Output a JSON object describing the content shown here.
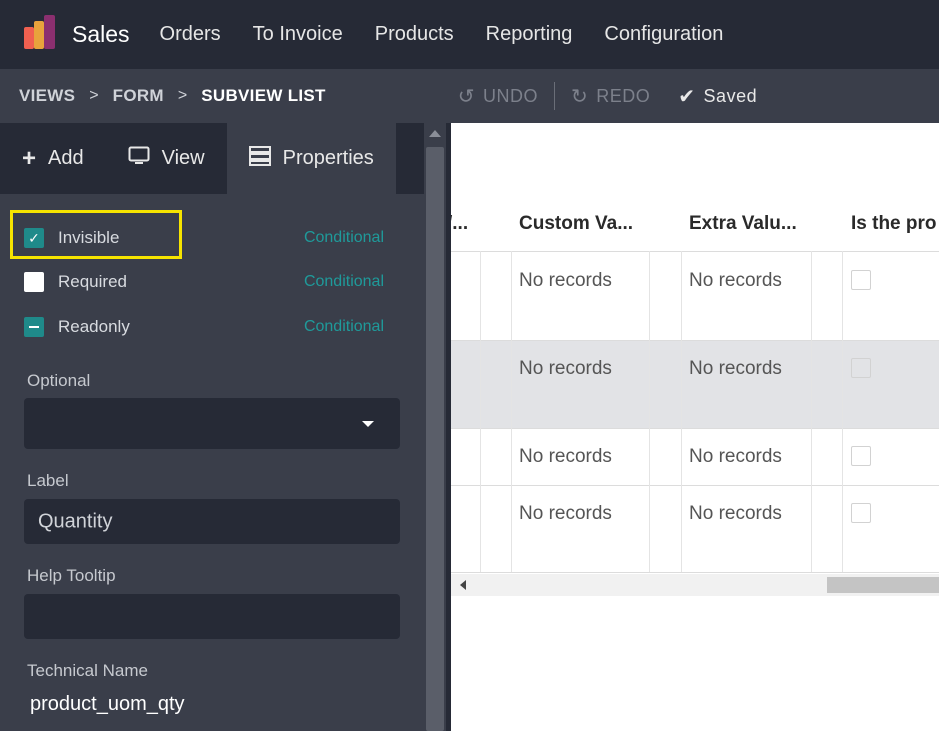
{
  "app": {
    "name": "Sales",
    "logo_colors": [
      "#f06050",
      "#e8a33c",
      "#8b2f6f"
    ]
  },
  "nav": {
    "items": [
      {
        "label": "Orders"
      },
      {
        "label": "To Invoice"
      },
      {
        "label": "Products"
      },
      {
        "label": "Reporting"
      },
      {
        "label": "Configuration"
      }
    ]
  },
  "breadcrumb": {
    "items": [
      "VIEWS",
      "FORM",
      "SUBVIEW LIST"
    ],
    "separator": ">"
  },
  "toolbar": {
    "undo_label": "UNDO",
    "redo_label": "REDO",
    "saved_label": "Saved",
    "undo_icon": "undo-icon",
    "redo_icon": "redo-icon",
    "saved_icon": "check-icon"
  },
  "sidebar": {
    "tabs": [
      {
        "label": "Add",
        "icon": "plus-icon"
      },
      {
        "label": "View",
        "icon": "monitor-icon"
      },
      {
        "label": "Properties",
        "icon": "properties-icon",
        "active": true
      }
    ],
    "properties": [
      {
        "label": "Invisible",
        "state": "checked",
        "conditional": "Conditional"
      },
      {
        "label": "Required",
        "state": "unchecked",
        "conditional": "Conditional"
      },
      {
        "label": "Readonly",
        "state": "indeterminate",
        "conditional": "Conditional"
      }
    ],
    "optional": {
      "label": "Optional",
      "value": ""
    },
    "label_field": {
      "label": "Label",
      "value": "Quantity"
    },
    "help_tooltip": {
      "label": "Help Tooltip",
      "value": ""
    },
    "technical_name": {
      "label": "Technical Name",
      "value": "product_uom_qty"
    }
  },
  "table": {
    "columns": [
      {
        "label": "/..."
      },
      {
        "label": "Custom Va..."
      },
      {
        "label": "Extra Valu..."
      },
      {
        "label": "Is the pro"
      }
    ],
    "rows": [
      {
        "custom": "No records",
        "extra": "No records",
        "checked": false
      },
      {
        "custom": "No records",
        "extra": "No records",
        "checked": false
      },
      {
        "custom": "No records",
        "extra": "No records",
        "checked": false
      },
      {
        "custom": "No records",
        "extra": "No records",
        "checked": false
      }
    ]
  },
  "colors": {
    "topbar": "#262a36",
    "panel": "#3a3e4a",
    "accent_teal": "#1f8a8a",
    "highlight": "#f6e400"
  }
}
